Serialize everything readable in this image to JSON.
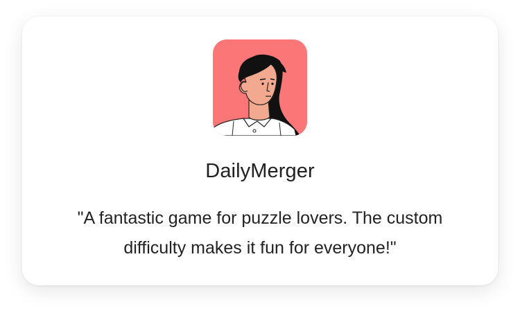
{
  "testimonial": {
    "avatar_icon": "person-avatar-icon",
    "avatar_bg_color": "#fb7676",
    "username": "DailyMerger",
    "quote": "\"A fantastic game for puzzle lovers. The custom difficulty makes it fun for everyone!\""
  }
}
